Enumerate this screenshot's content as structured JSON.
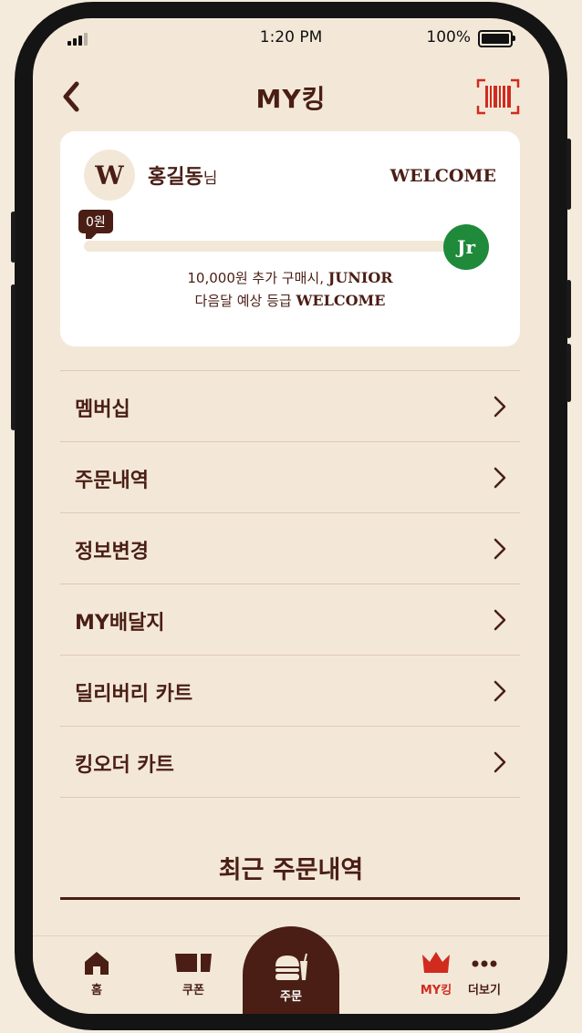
{
  "status_bar": {
    "time": "1:20 PM",
    "battery": "100%"
  },
  "header": {
    "title": "MY킹",
    "back_icon": "chevron-left-icon",
    "barcode_icon": "barcode-icon"
  },
  "membership": {
    "avatar_letter": "W",
    "name": "홍길동",
    "honorific": "님",
    "grade": "WELCOME",
    "points_label": "0원",
    "progress": 0,
    "next_grade_badge": "Jr",
    "msg_line1_prefix": "10,000원 추가 구매시, ",
    "msg_line1_grade": "JUNIOR",
    "msg_line2_prefix": "다음달 예상 등급 ",
    "msg_line2_grade": "WELCOME",
    "colors": {
      "badge_green": "#1f8a3a",
      "brown": "#4a1e14",
      "accent_red": "#d12a1e"
    }
  },
  "menu": {
    "items": [
      {
        "label": "멤버십"
      },
      {
        "label": "주문내역"
      },
      {
        "label": "정보변경"
      },
      {
        "label": "MY배달지"
      },
      {
        "label": "딜리버리 카트"
      },
      {
        "label": "킹오더 카트"
      }
    ]
  },
  "recent_orders": {
    "title": "최근 주문내역"
  },
  "tabbar": {
    "tabs": [
      {
        "label": "홈",
        "icon": "home-icon"
      },
      {
        "label": "쿠폰",
        "icon": "coupon-icon"
      },
      {
        "label": "주문",
        "icon": "burger-icon"
      },
      {
        "label": "MY킹",
        "icon": "crown-icon"
      },
      {
        "label": "더보기",
        "icon": "more-icon"
      }
    ]
  }
}
